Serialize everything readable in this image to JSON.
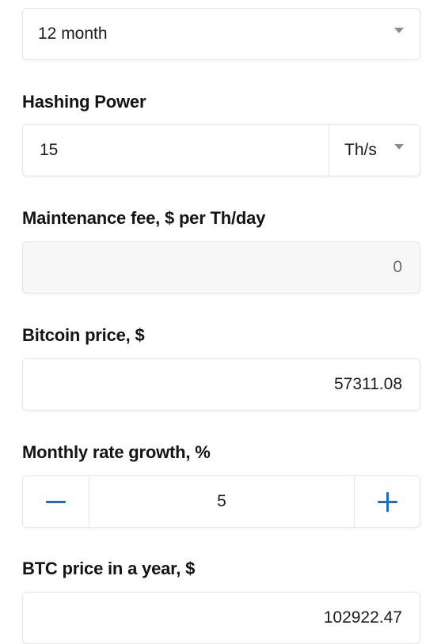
{
  "period_select": {
    "value": "12 month",
    "icon": "chevron-down-icon"
  },
  "hashing_power": {
    "label": "Hashing Power",
    "value": "15",
    "unit": "Th/s",
    "unit_icon": "chevron-down-icon"
  },
  "maintenance_fee": {
    "label": "Maintenance fee, $ per Th/day",
    "value": "0",
    "disabled": true
  },
  "bitcoin_price": {
    "label": "Bitcoin price, $",
    "value": "57311.08"
  },
  "monthly_rate_growth": {
    "label": "Monthly rate growth, %",
    "value": "5",
    "decrement_icon": "minus-icon",
    "increment_icon": "plus-icon",
    "accent_color": "#1a6fc4"
  },
  "btc_price_year": {
    "label": "BTC price in a year, $",
    "value": "102922.47"
  }
}
